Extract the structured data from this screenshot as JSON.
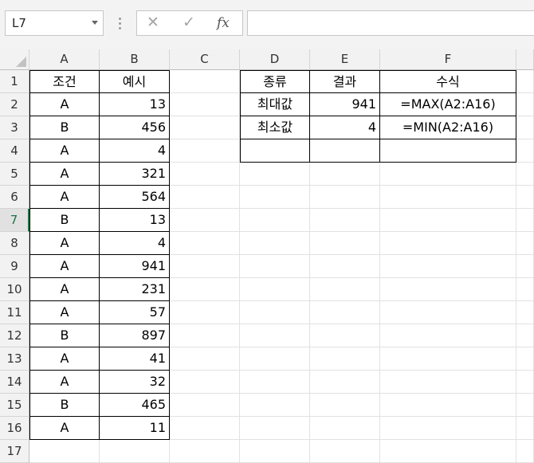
{
  "formula_bar": {
    "name_box": "L7",
    "cancel_icon": "✕",
    "enter_icon": "✓",
    "fx_label": "fx",
    "formula": ""
  },
  "columns": [
    "A",
    "B",
    "C",
    "D",
    "E",
    "F"
  ],
  "rows": [
    "1",
    "2",
    "3",
    "4",
    "5",
    "6",
    "7",
    "8",
    "9",
    "10",
    "11",
    "12",
    "13",
    "14",
    "15",
    "16",
    "17"
  ],
  "active_cell": "L7",
  "table1": {
    "headers": [
      "조건",
      "예시"
    ],
    "data": [
      [
        "A",
        "13"
      ],
      [
        "B",
        "456"
      ],
      [
        "A",
        "4"
      ],
      [
        "A",
        "321"
      ],
      [
        "A",
        "564"
      ],
      [
        "B",
        "13"
      ],
      [
        "A",
        "4"
      ],
      [
        "A",
        "941"
      ],
      [
        "A",
        "231"
      ],
      [
        "A",
        "57"
      ],
      [
        "B",
        "897"
      ],
      [
        "A",
        "41"
      ],
      [
        "A",
        "32"
      ],
      [
        "B",
        "465"
      ],
      [
        "A",
        "11"
      ]
    ]
  },
  "table2": {
    "headers": [
      "종류",
      "결과",
      "수식"
    ],
    "data": [
      [
        "최대값",
        "941",
        "=MAX(A2:A16)"
      ],
      [
        "최소값",
        "4",
        "=MIN(A2:A16)"
      ],
      [
        "",
        "",
        ""
      ]
    ]
  },
  "colors": {
    "accent": "#217346",
    "header_bg": "#f2f2f2",
    "gridline": "#e1e1e1"
  }
}
